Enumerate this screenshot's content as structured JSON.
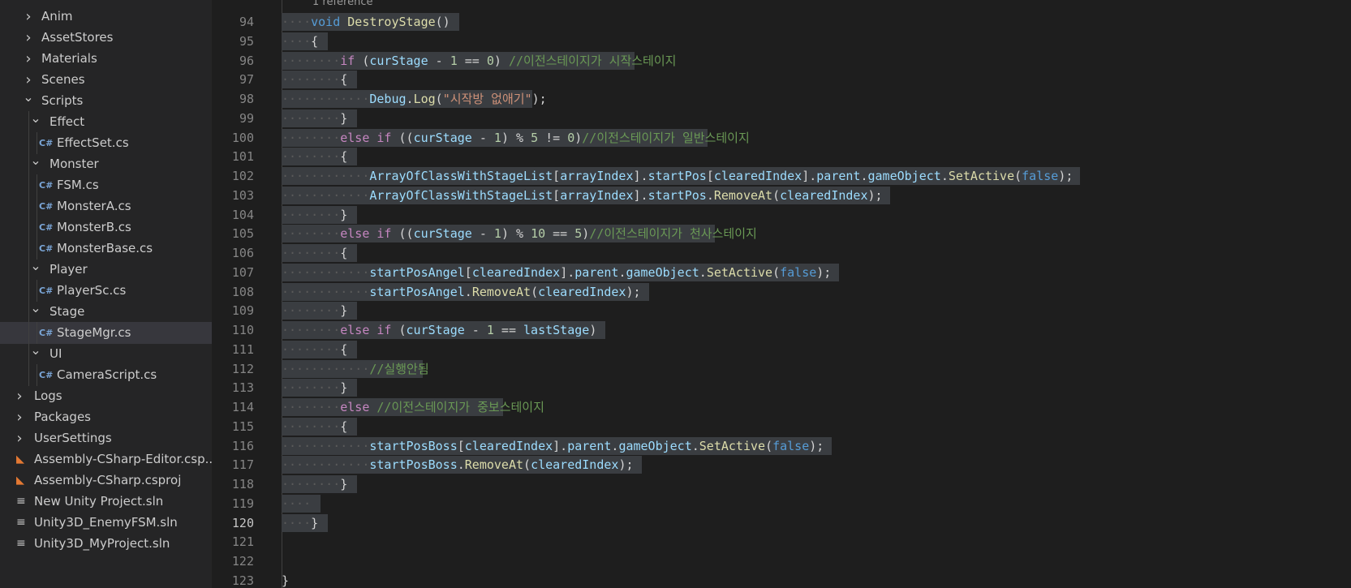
{
  "explorer": {
    "items": [
      {
        "label": "Anim",
        "type": "folder",
        "expanded": false,
        "depth": 1
      },
      {
        "label": "AssetStores",
        "type": "folder",
        "expanded": false,
        "depth": 1
      },
      {
        "label": "Materials",
        "type": "folder",
        "expanded": false,
        "depth": 1
      },
      {
        "label": "Scenes",
        "type": "folder",
        "expanded": false,
        "depth": 1
      },
      {
        "label": "Scripts",
        "type": "folder",
        "expanded": true,
        "depth": 1
      },
      {
        "label": "Effect",
        "type": "folder",
        "expanded": true,
        "depth": 2
      },
      {
        "label": "EffectSet.cs",
        "type": "cs",
        "depth": 3
      },
      {
        "label": "Monster",
        "type": "folder",
        "expanded": true,
        "depth": 2
      },
      {
        "label": "FSM.cs",
        "type": "cs",
        "depth": 3
      },
      {
        "label": "MonsterA.cs",
        "type": "cs",
        "depth": 3
      },
      {
        "label": "MonsterB.cs",
        "type": "cs",
        "depth": 3
      },
      {
        "label": "MonsterBase.cs",
        "type": "cs",
        "depth": 3
      },
      {
        "label": "Player",
        "type": "folder",
        "expanded": true,
        "depth": 2
      },
      {
        "label": "PlayerSc.cs",
        "type": "cs",
        "depth": 3
      },
      {
        "label": "Stage",
        "type": "folder",
        "expanded": true,
        "depth": 2
      },
      {
        "label": "StageMgr.cs",
        "type": "cs",
        "depth": 3,
        "selected": true
      },
      {
        "label": "UI",
        "type": "folder",
        "expanded": true,
        "depth": 2
      },
      {
        "label": "CameraScript.cs",
        "type": "cs",
        "depth": 3
      },
      {
        "label": "Logs",
        "type": "folder",
        "expanded": false,
        "depth": 0
      },
      {
        "label": "Packages",
        "type": "folder",
        "expanded": false,
        "depth": 0
      },
      {
        "label": "UserSettings",
        "type": "folder",
        "expanded": false,
        "depth": 0
      },
      {
        "label": "Assembly-CSharp-Editor.csp...",
        "type": "rss",
        "depth": 0
      },
      {
        "label": "Assembly-CSharp.csproj",
        "type": "rss",
        "depth": 0
      },
      {
        "label": "New Unity Project.sln",
        "type": "sln",
        "depth": 0
      },
      {
        "label": "Unity3D_EnemyFSM.sln",
        "type": "sln",
        "depth": 0
      },
      {
        "label": "Unity3D_MyProject.sln",
        "type": "sln",
        "depth": 0
      }
    ]
  },
  "editor": {
    "codelens": "1 reference",
    "active_line": "120",
    "lines": [
      {
        "num": "94",
        "indent": 1,
        "sel": true,
        "tokens": [
          [
            "kw",
            "void"
          ],
          [
            "pun",
            " "
          ],
          [
            "fn",
            "DestroyStage"
          ],
          [
            "pun",
            "()"
          ]
        ]
      },
      {
        "num": "95",
        "indent": 1,
        "sel": true,
        "tokens": [
          [
            "pun",
            "{"
          ]
        ]
      },
      {
        "num": "96",
        "indent": 2,
        "sel": true,
        "tokens": [
          [
            "ctl",
            "if"
          ],
          [
            "pun",
            " ("
          ],
          [
            "var",
            "curStage"
          ],
          [
            "pun",
            " - "
          ],
          [
            "num",
            "1"
          ],
          [
            "pun",
            " == "
          ],
          [
            "num",
            "0"
          ],
          [
            "pun",
            ") "
          ],
          [
            "cmt",
            "//이전스테이지가 시작스테이지"
          ]
        ]
      },
      {
        "num": "97",
        "indent": 2,
        "sel": true,
        "tokens": [
          [
            "pun",
            "{"
          ]
        ]
      },
      {
        "num": "98",
        "indent": 3,
        "sel": true,
        "tokens": [
          [
            "var",
            "Debug"
          ],
          [
            "pun",
            "."
          ],
          [
            "fn",
            "Log"
          ],
          [
            "pun",
            "("
          ],
          [
            "str",
            "\"시작방 없애기\""
          ],
          [
            "pun",
            ");"
          ]
        ]
      },
      {
        "num": "99",
        "indent": 2,
        "sel": true,
        "tokens": [
          [
            "pun",
            "}"
          ]
        ]
      },
      {
        "num": "100",
        "indent": 2,
        "sel": true,
        "tokens": [
          [
            "ctl",
            "else"
          ],
          [
            "pun",
            " "
          ],
          [
            "ctl",
            "if"
          ],
          [
            "pun",
            " (("
          ],
          [
            "var",
            "curStage"
          ],
          [
            "pun",
            " - "
          ],
          [
            "num",
            "1"
          ],
          [
            "pun",
            ") % "
          ],
          [
            "num",
            "5"
          ],
          [
            "pun",
            " != "
          ],
          [
            "num",
            "0"
          ],
          [
            "pun",
            ")"
          ],
          [
            "cmt",
            "//이전스테이지가 일반스테이지"
          ]
        ]
      },
      {
        "num": "101",
        "indent": 2,
        "sel": true,
        "tokens": [
          [
            "pun",
            "{"
          ]
        ]
      },
      {
        "num": "102",
        "indent": 3,
        "sel": true,
        "tokens": [
          [
            "var",
            "ArrayOfClassWithStageList"
          ],
          [
            "pun",
            "["
          ],
          [
            "var",
            "arrayIndex"
          ],
          [
            "pun",
            "]."
          ],
          [
            "var",
            "startPos"
          ],
          [
            "pun",
            "["
          ],
          [
            "var",
            "clearedIndex"
          ],
          [
            "pun",
            "]."
          ],
          [
            "var",
            "parent"
          ],
          [
            "pun",
            "."
          ],
          [
            "var",
            "gameObject"
          ],
          [
            "pun",
            "."
          ],
          [
            "fn",
            "SetActive"
          ],
          [
            "pun",
            "("
          ],
          [
            "kw",
            "false"
          ],
          [
            "pun",
            ");"
          ]
        ]
      },
      {
        "num": "103",
        "indent": 3,
        "sel": true,
        "tokens": [
          [
            "var",
            "ArrayOfClassWithStageList"
          ],
          [
            "pun",
            "["
          ],
          [
            "var",
            "arrayIndex"
          ],
          [
            "pun",
            "]."
          ],
          [
            "var",
            "startPos"
          ],
          [
            "pun",
            "."
          ],
          [
            "fn",
            "RemoveAt"
          ],
          [
            "pun",
            "("
          ],
          [
            "var",
            "clearedIndex"
          ],
          [
            "pun",
            ");"
          ]
        ]
      },
      {
        "num": "104",
        "indent": 2,
        "sel": true,
        "tokens": [
          [
            "pun",
            "}"
          ]
        ]
      },
      {
        "num": "105",
        "indent": 2,
        "sel": true,
        "tokens": [
          [
            "ctl",
            "else"
          ],
          [
            "pun",
            " "
          ],
          [
            "ctl",
            "if"
          ],
          [
            "pun",
            " (("
          ],
          [
            "var",
            "curStage"
          ],
          [
            "pun",
            " - "
          ],
          [
            "num",
            "1"
          ],
          [
            "pun",
            ") % "
          ],
          [
            "num",
            "10"
          ],
          [
            "pun",
            " == "
          ],
          [
            "num",
            "5"
          ],
          [
            "pun",
            ")"
          ],
          [
            "cmt",
            "//이전스테이지가 천사스테이지"
          ]
        ]
      },
      {
        "num": "106",
        "indent": 2,
        "sel": true,
        "tokens": [
          [
            "pun",
            "{"
          ]
        ]
      },
      {
        "num": "107",
        "indent": 3,
        "sel": true,
        "tokens": [
          [
            "var",
            "startPosAngel"
          ],
          [
            "pun",
            "["
          ],
          [
            "var",
            "clearedIndex"
          ],
          [
            "pun",
            "]."
          ],
          [
            "var",
            "parent"
          ],
          [
            "pun",
            "."
          ],
          [
            "var",
            "gameObject"
          ],
          [
            "pun",
            "."
          ],
          [
            "fn",
            "SetActive"
          ],
          [
            "pun",
            "("
          ],
          [
            "kw",
            "false"
          ],
          [
            "pun",
            ");"
          ]
        ]
      },
      {
        "num": "108",
        "indent": 3,
        "sel": true,
        "tokens": [
          [
            "var",
            "startPosAngel"
          ],
          [
            "pun",
            "."
          ],
          [
            "fn",
            "RemoveAt"
          ],
          [
            "pun",
            "("
          ],
          [
            "var",
            "clearedIndex"
          ],
          [
            "pun",
            ");"
          ]
        ]
      },
      {
        "num": "109",
        "indent": 2,
        "sel": true,
        "tokens": [
          [
            "pun",
            "}"
          ]
        ]
      },
      {
        "num": "110",
        "indent": 2,
        "sel": true,
        "tokens": [
          [
            "ctl",
            "else"
          ],
          [
            "pun",
            " "
          ],
          [
            "ctl",
            "if"
          ],
          [
            "pun",
            " ("
          ],
          [
            "var",
            "curStage"
          ],
          [
            "pun",
            " - "
          ],
          [
            "num",
            "1"
          ],
          [
            "pun",
            " == "
          ],
          [
            "var",
            "lastStage"
          ],
          [
            "pun",
            ")"
          ]
        ]
      },
      {
        "num": "111",
        "indent": 2,
        "sel": true,
        "tokens": [
          [
            "pun",
            "{"
          ]
        ]
      },
      {
        "num": "112",
        "indent": 3,
        "sel": true,
        "tokens": [
          [
            "cmt",
            "//실행안됨"
          ]
        ]
      },
      {
        "num": "113",
        "indent": 2,
        "sel": true,
        "tokens": [
          [
            "pun",
            "}"
          ]
        ]
      },
      {
        "num": "114",
        "indent": 2,
        "sel": true,
        "tokens": [
          [
            "ctl",
            "else"
          ],
          [
            "pun",
            " "
          ],
          [
            "cmt",
            "//이전스테이지가 중보스테이지"
          ]
        ]
      },
      {
        "num": "115",
        "indent": 2,
        "sel": true,
        "tokens": [
          [
            "pun",
            "{"
          ]
        ]
      },
      {
        "num": "116",
        "indent": 3,
        "sel": true,
        "tokens": [
          [
            "var",
            "startPosBoss"
          ],
          [
            "pun",
            "["
          ],
          [
            "var",
            "clearedIndex"
          ],
          [
            "pun",
            "]."
          ],
          [
            "var",
            "parent"
          ],
          [
            "pun",
            "."
          ],
          [
            "var",
            "gameObject"
          ],
          [
            "pun",
            "."
          ],
          [
            "fn",
            "SetActive"
          ],
          [
            "pun",
            "("
          ],
          [
            "kw",
            "false"
          ],
          [
            "pun",
            ");"
          ]
        ]
      },
      {
        "num": "117",
        "indent": 3,
        "sel": true,
        "tokens": [
          [
            "var",
            "startPosBoss"
          ],
          [
            "pun",
            "."
          ],
          [
            "fn",
            "RemoveAt"
          ],
          [
            "pun",
            "("
          ],
          [
            "var",
            "clearedIndex"
          ],
          [
            "pun",
            ");"
          ]
        ]
      },
      {
        "num": "118",
        "indent": 2,
        "sel": true,
        "tokens": [
          [
            "pun",
            "}"
          ]
        ]
      },
      {
        "num": "119",
        "indent": 1,
        "sel": true,
        "tokens": []
      },
      {
        "num": "120",
        "indent": 1,
        "sel": true,
        "tokens": [
          [
            "pun",
            "}"
          ]
        ]
      },
      {
        "num": "121",
        "indent": 0,
        "sel": false,
        "tokens": []
      },
      {
        "num": "122",
        "indent": 0,
        "sel": false,
        "tokens": []
      },
      {
        "num": "123",
        "indent": 0,
        "sel": false,
        "tokens": [
          [
            "pun",
            "}"
          ]
        ]
      }
    ]
  }
}
